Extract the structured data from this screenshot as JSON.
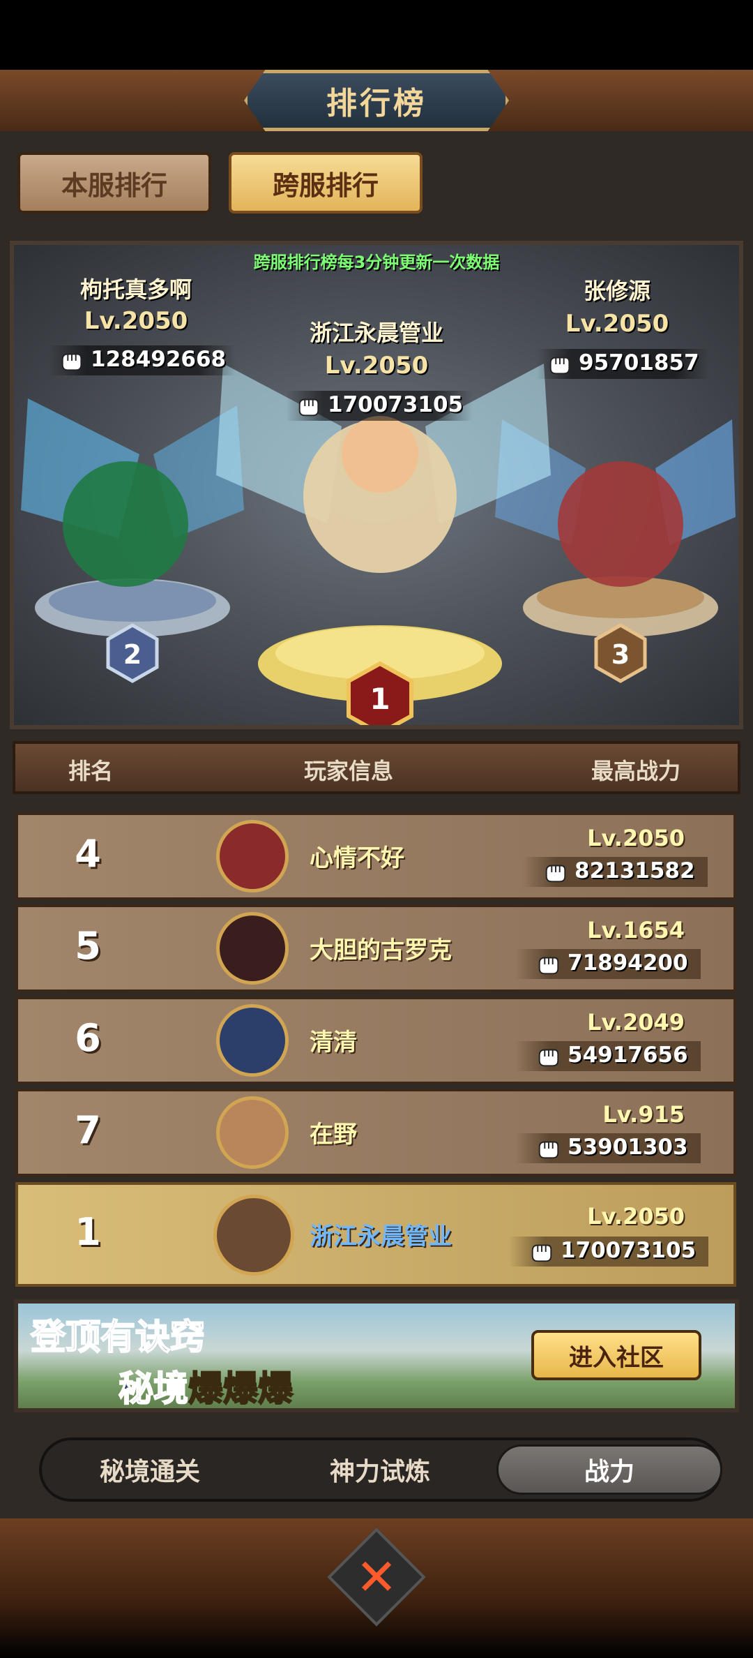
{
  "header": {
    "title": "排行榜"
  },
  "tabs": {
    "local": "本服排行",
    "cross": "跨服排行",
    "active": "cross"
  },
  "podium": {
    "note": "跨服排行榜每3分钟更新一次数据",
    "first": {
      "rank": "1",
      "name": "浙江永晨管业",
      "level": "Lv.2050",
      "power": "170073105"
    },
    "second": {
      "rank": "2",
      "name": "枸托真多啊",
      "level": "Lv.2050",
      "power": "128492668"
    },
    "third": {
      "rank": "3",
      "name": "张修源",
      "level": "Lv.2050",
      "power": "95701857"
    }
  },
  "table": {
    "col_rank": "排名",
    "col_info": "玩家信息",
    "col_power": "最高战力",
    "rows": [
      {
        "rank": "4",
        "name": "心情不好",
        "level": "Lv.2050",
        "power": "82131582"
      },
      {
        "rank": "5",
        "name": "大胆的古罗克",
        "level": "Lv.1654",
        "power": "71894200"
      },
      {
        "rank": "6",
        "name": "清清",
        "level": "Lv.2049",
        "power": "54917656"
      },
      {
        "rank": "7",
        "name": "在野",
        "level": "Lv.915",
        "power": "53901303"
      }
    ],
    "me": {
      "rank": "1",
      "name": "浙江永晨管业",
      "level": "Lv.2050",
      "power": "170073105"
    }
  },
  "banner": {
    "line1": "登顶有诀窍",
    "line2_a": "秘境",
    "line2_b": "爆爆爆",
    "button": "进入社区"
  },
  "bottom_tabs": {
    "dungeon": "秘境通关",
    "trial": "神力试炼",
    "power": "战力",
    "active": "power"
  },
  "colors": {
    "name_highlight": "#6fb7ff",
    "update_note": "#7dff74",
    "gold": "#e3b45a"
  },
  "icons": [
    "fist-icon",
    "close-icon",
    "rank-badge-icon"
  ]
}
